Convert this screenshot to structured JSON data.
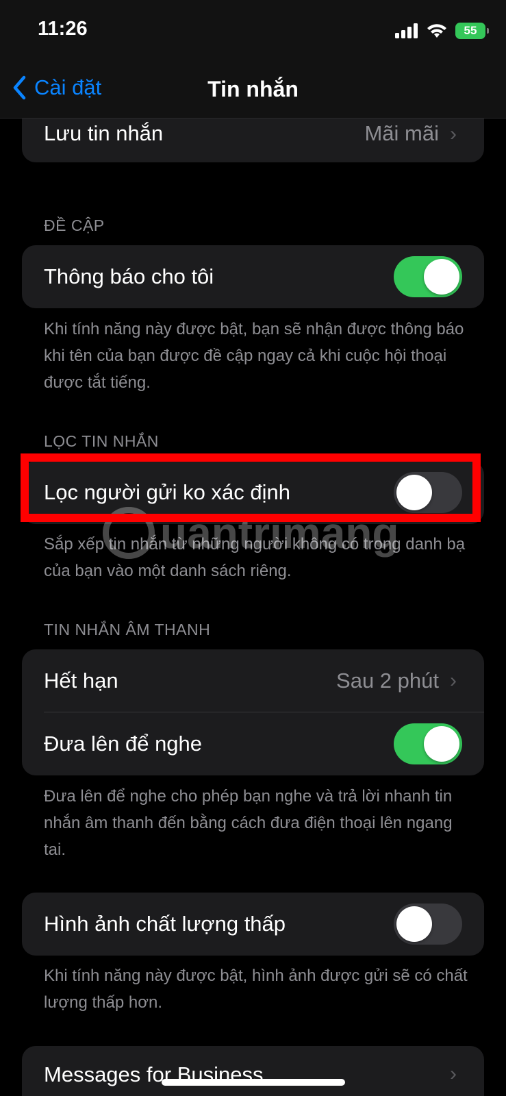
{
  "status_bar": {
    "time": "11:26",
    "battery": "55"
  },
  "nav": {
    "back_label": "Cài đặt",
    "title": "Tin nhắn"
  },
  "storage_group": {
    "label": "Lưu tin nhắn",
    "value": "Mãi mãi"
  },
  "mentions": {
    "header": "ĐỀ CẬP",
    "notify_label": "Thông báo cho tôi",
    "notify_on": true,
    "footer": "Khi tính năng này được bật, bạn sẽ nhận được thông báo khi tên của bạn được đề cập ngay cả khi cuộc hội thoại được tắt tiếng."
  },
  "filtering": {
    "header": "LỌC TIN NHẮN",
    "filter_label": "Lọc người gửi ko xác định",
    "filter_on": false,
    "footer": "Sắp xếp tin nhắn từ những người không có trong danh bạ của bạn vào một danh sách riêng."
  },
  "audio": {
    "header": "TIN NHẮN ÂM THANH",
    "expire_label": "Hết hạn",
    "expire_value": "Sau 2 phút",
    "raise_label": "Đưa lên để nghe",
    "raise_on": true,
    "footer": "Đưa lên để nghe cho phép bạn nghe và trả lời nhanh tin nhắn âm thanh đến bằng cách đưa điện thoại lên ngang tai."
  },
  "low_quality": {
    "label": "Hình ảnh chất lượng thấp",
    "on": false,
    "footer": "Khi tính năng này được bật, hình ảnh được gửi sẽ có chất lượng thấp hơn."
  },
  "business": {
    "label": "Messages for Business"
  },
  "watermark": "uantrimang",
  "colors": {
    "accent": "#0a84ff",
    "toggle_on": "#34c759",
    "highlight": "#ff0000"
  }
}
